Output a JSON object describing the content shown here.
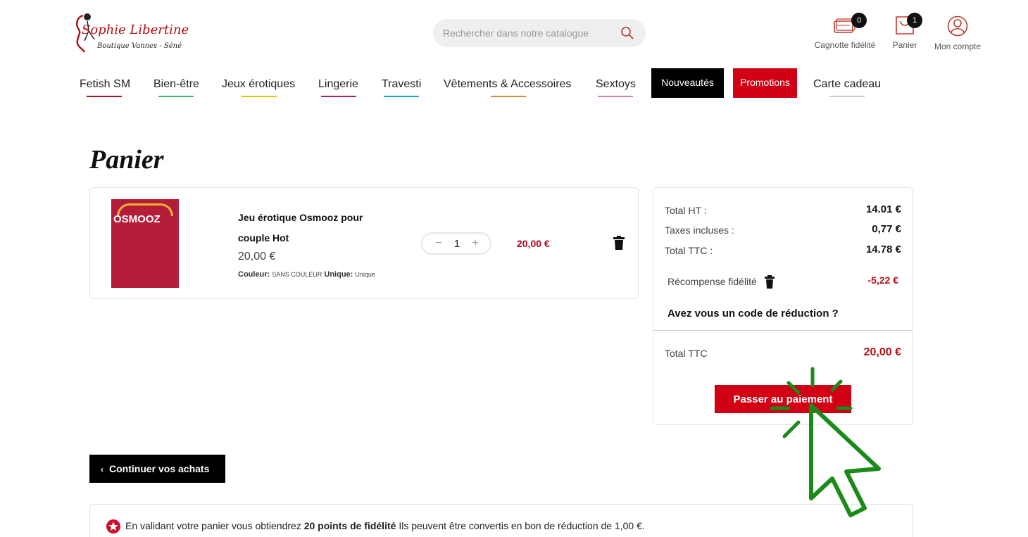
{
  "header": {
    "logo_title": "Sophie Libertine",
    "logo_subtitle": "Boutique Vannes - Séné",
    "search_placeholder": "Rechercher dans notre catalogue",
    "icons": [
      {
        "name": "cagnotte-icon",
        "label": "Cagnotte fidélité",
        "badge": "0"
      },
      {
        "name": "cart-icon",
        "label": "Panier",
        "badge": "1"
      },
      {
        "name": "user-icon",
        "label": "Mon compte"
      }
    ]
  },
  "nav": {
    "items": [
      {
        "label": "Fetish SM",
        "underline": "#b01020"
      },
      {
        "label": "Bien-être",
        "underline": "#3cb371"
      },
      {
        "label": "Jeux érotiques",
        "underline": "#e6c200"
      },
      {
        "label": "Lingerie",
        "underline": "#b0207a"
      },
      {
        "label": "Travesti",
        "underline": "#1aa6c6"
      },
      {
        "label": "Vêtements & Accessoires",
        "underline": "#d98a3a"
      },
      {
        "label": "Sextoys",
        "underline": "#e07aa8"
      },
      {
        "label": "Nouveautés"
      },
      {
        "label": "Promotions"
      },
      {
        "label": "Carte cadeau",
        "underline": "#cccccc"
      }
    ]
  },
  "page_title": "Panier",
  "cart": {
    "product": {
      "image_text": "OSMOOZ",
      "name": "Jeu érotique Osmooz pour couple Hot",
      "price": "20,00 €",
      "attr1_label": "Couleur:",
      "attr1_value": "SANS COULEUR",
      "attr2_label": "Unique:",
      "attr2_value": "Unique",
      "quantity": "1",
      "line_total": "20,00 €"
    }
  },
  "summary": {
    "total_ht_label": "Total HT :",
    "total_ht_value": "14.01 €",
    "taxes_label": "Taxes incluses :",
    "taxes_value": "0,77 €",
    "total_ttc_label": "Total TTC :",
    "total_ttc_value": "14.78 €",
    "reward_label": "Récompense fidélité",
    "reward_value": "-5,22 €",
    "promo_question": "Avez vous un code de réduction ?",
    "final_label": "Total TTC",
    "final_value": "20,00 €",
    "pay_button": "Passer au paiement"
  },
  "continue_button": "Continuer vos achats",
  "loyalty": {
    "text_before": "En validant votre panier vous obtiendrez",
    "points": "20 points de fidélité",
    "text_after": "Ils peuvent être convertis en bon de réduction de 1,00 €."
  },
  "colors": {
    "accent_red": "#d10014",
    "price_red": "#b50e18",
    "cursor_green": "#1a8a1a"
  }
}
